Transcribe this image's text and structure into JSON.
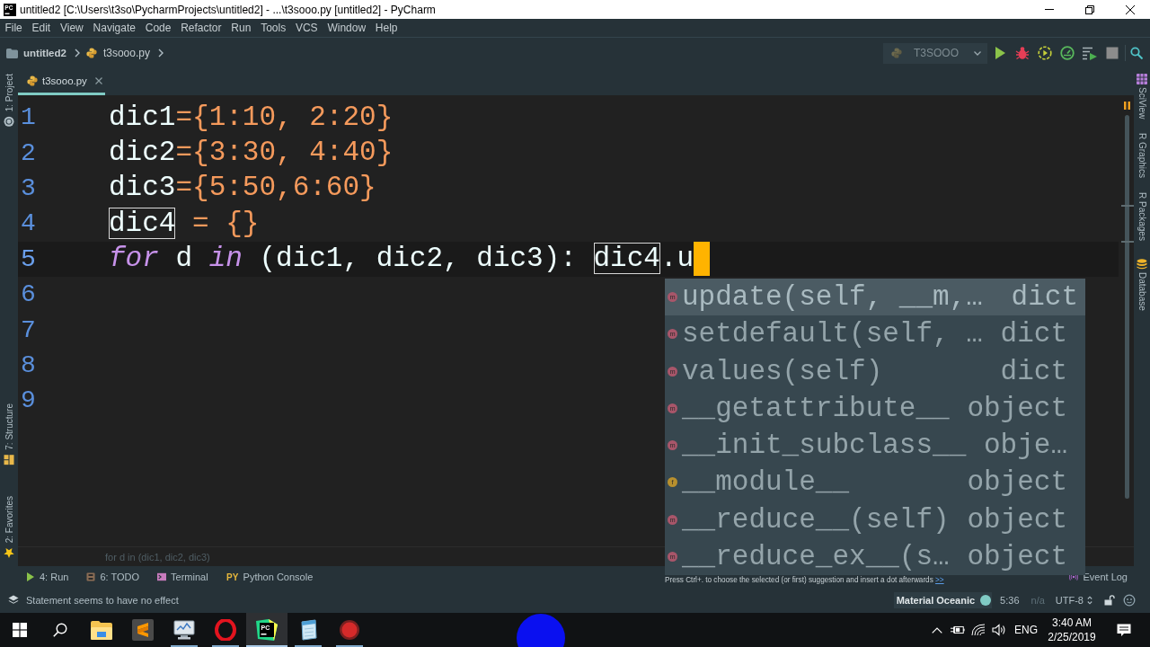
{
  "window": {
    "logo_text": "PC",
    "title": "untitled2 [C:\\Users\\t3so\\PycharmProjects\\untitled2] - ...\\t3sooo.py [untitled2] - PyCharm"
  },
  "menu": [
    "File",
    "Edit",
    "View",
    "Navigate",
    "Code",
    "Refactor",
    "Run",
    "Tools",
    "VCS",
    "Window",
    "Help"
  ],
  "navigation": {
    "breadcrumbs": [
      {
        "label": "untitled2",
        "kind": "project"
      },
      {
        "label": "t3sooo.py",
        "kind": "file"
      }
    ],
    "run_configuration": "T3SOOO"
  },
  "left_tool_strip": [
    {
      "label": "1: Project",
      "kind": "project"
    },
    {
      "label": "7: Structure",
      "kind": "structure"
    },
    {
      "label": "2: Favorites",
      "kind": "favorites"
    }
  ],
  "tabs": [
    {
      "label": "t3sooo.py",
      "selected": true
    }
  ],
  "editor": {
    "lines": [
      {
        "number": "1",
        "current": false,
        "tokens": [
          {
            "text": "dic1",
            "kind": "name"
          },
          {
            "text": "={1:10, 2:20}",
            "kind": "literal"
          }
        ]
      },
      {
        "number": "2",
        "current": false,
        "tokens": [
          {
            "text": "dic2",
            "kind": "name"
          },
          {
            "text": "={3:30, 4:40}",
            "kind": "literal"
          }
        ]
      },
      {
        "number": "3",
        "current": false,
        "tokens": [
          {
            "text": "dic3",
            "kind": "name"
          },
          {
            "text": "={5:50,6:60}",
            "kind": "literal"
          }
        ]
      },
      {
        "number": "4",
        "current": false,
        "tokens": [
          {
            "text": "dic4",
            "kind": "usage"
          },
          {
            "text": " = {}",
            "kind": "literal"
          }
        ]
      },
      {
        "number": "5",
        "current": true,
        "tokens": [
          {
            "text": "for",
            "kind": "keyword"
          },
          {
            "text": " d ",
            "kind": "name"
          },
          {
            "text": "in",
            "kind": "keyword"
          },
          {
            "text": " (dic1, dic2, dic3): ",
            "kind": "name"
          },
          {
            "text": "dic4",
            "kind": "usage"
          },
          {
            "text": ".u",
            "kind": "name"
          }
        ]
      },
      {
        "number": "6",
        "current": false
      },
      {
        "number": "7",
        "current": false
      },
      {
        "number": "8",
        "current": false
      },
      {
        "number": "9",
        "current": false
      }
    ]
  },
  "completion": {
    "items": [
      {
        "name": "update(self, __m,…",
        "type": "dict",
        "kind": "method",
        "icon_letter": "m",
        "selected": true
      },
      {
        "name": "setdefault(self, …",
        "type": "dict",
        "kind": "method",
        "icon_letter": "m",
        "selected": false
      },
      {
        "name": "values(self)",
        "type": "dict",
        "kind": "method",
        "icon_letter": "m",
        "selected": false
      },
      {
        "name": "__getattribute__",
        "type": "object",
        "kind": "method",
        "icon_letter": "m",
        "selected": false
      },
      {
        "name": "__init_subclass__",
        "type": "obje…",
        "kind": "method",
        "icon_letter": "m",
        "selected": false
      },
      {
        "name": "__module__",
        "type": "object",
        "kind": "field",
        "icon_letter": "f",
        "selected": false
      },
      {
        "name": "__reduce__(self)",
        "type": "object",
        "kind": "method",
        "icon_letter": "m",
        "selected": false
      },
      {
        "name": "__reduce_ex__(s…",
        "type": "object",
        "kind": "method",
        "icon_letter": "m",
        "selected": false
      }
    ],
    "hint": "Press Ctrl+. to choose the selected (or first) suggestion and insert a dot afterwards",
    "hint_link": ">>"
  },
  "right_tool_strip": [
    {
      "label": "SciView",
      "kind": "sciview"
    },
    {
      "label": "R Graphics",
      "kind": "plain"
    },
    {
      "label": "R Packages",
      "kind": "plain"
    },
    {
      "label": "Database",
      "kind": "database"
    }
  ],
  "editor_breadcrumb": "for d in (dic1, dic2, dic3)",
  "tool_windows": [
    {
      "label": "4: Run",
      "kind": "run"
    },
    {
      "label": "6: TODO",
      "kind": "todo"
    },
    {
      "label": "Terminal",
      "kind": "terminal"
    },
    {
      "label": "Python Console",
      "kind": "console",
      "icon_text": "PY"
    },
    {
      "label": "Event Log",
      "kind": "event-log"
    }
  ],
  "status_bar": {
    "message": "Statement seems to have no effect",
    "theme": "Material Oceanic",
    "position": "5:36",
    "line_separator": "n/a",
    "encoding": "UTF-8"
  },
  "taskbar": {
    "apps": [
      {
        "kind": "explorer",
        "open": false,
        "selected": false
      },
      {
        "kind": "sublime",
        "open": false,
        "selected": false
      },
      {
        "kind": "monitor",
        "open": true,
        "selected": false
      },
      {
        "kind": "opera",
        "open": true,
        "selected": false
      },
      {
        "kind": "pycharm",
        "open": true,
        "selected": true,
        "logo_text": "PC"
      },
      {
        "kind": "notepad",
        "open": true,
        "selected": false
      },
      {
        "kind": "recorder",
        "open": true,
        "selected": false
      }
    ],
    "language": "ENG",
    "time": "3:40 AM",
    "date": "2/25/2019"
  }
}
